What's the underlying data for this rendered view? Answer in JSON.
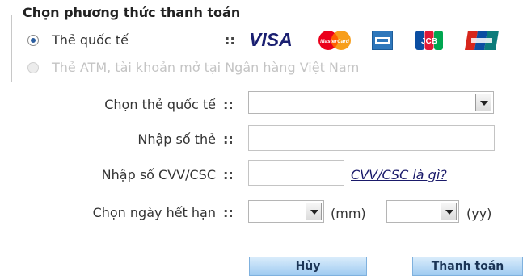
{
  "payment": {
    "legend": "Chọn phương thức thanh toán",
    "methods": [
      {
        "label": "Thẻ quốc tế",
        "selected": true,
        "disabled": false
      },
      {
        "label": "Thẻ ATM, tài khoản mở tại Ngân hàng Việt Nam",
        "selected": false,
        "disabled": true
      }
    ],
    "separator": "::",
    "card_logos": [
      {
        "name": "visa",
        "text": "VISA",
        "color": "#1a1f71"
      },
      {
        "name": "mastercard",
        "text": "MasterCard",
        "color": "#eb001b"
      },
      {
        "name": "amex",
        "text": "",
        "color": "#2e77bb"
      },
      {
        "name": "jcb",
        "text": "JCB",
        "color": "#0b4ea2"
      },
      {
        "name": "unionpay",
        "text": "",
        "color": "#d7261c"
      }
    ]
  },
  "form": {
    "card_type_label": "Chọn thẻ quốc tế",
    "card_number_label": "Nhập số thẻ",
    "cvv_label": "Nhập số CVV/CSC",
    "cvv_help_link": "CVV/CSC là gì?",
    "expiry_label": "Chọn ngày hết hạn",
    "month_unit": "(mm)",
    "year_unit": "(yy)",
    "separator": "::"
  },
  "buttons": {
    "cancel": "Hủy",
    "pay": "Thanh toán"
  }
}
